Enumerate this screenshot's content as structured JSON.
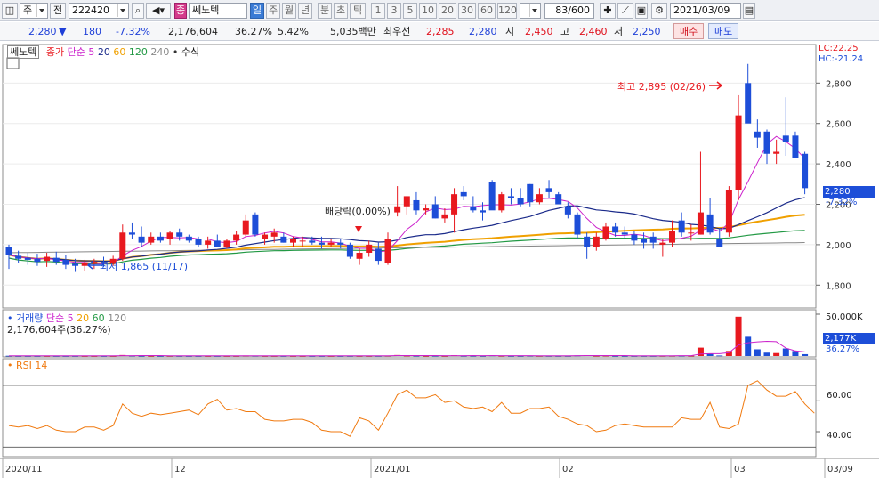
{
  "toolbar": {
    "market_tab": "주",
    "prev_label": "전",
    "code": "222420",
    "stock_name": "쎄노텍",
    "name_badge": "종",
    "periods": [
      "일",
      "주",
      "월",
      "년",
      "분",
      "초",
      "틱"
    ],
    "active_period": "일",
    "intervals": [
      "1",
      "3",
      "5",
      "10",
      "20",
      "30",
      "60",
      "120"
    ],
    "count": "83/600",
    "date": "2021/03/09"
  },
  "quote": {
    "price": "2,280",
    "direction": "▼",
    "change": "180",
    "change_pct": "-7.32%",
    "volume": "2,176,604",
    "volume_ratio": "36.27%",
    "turnover": "5.42%",
    "amount": "5,035백만",
    "best_label": "최우선",
    "best_ask": "2,285",
    "best_bid": "2,280",
    "open_label": "시",
    "open": "2,450",
    "high_label": "고",
    "high": "2,460",
    "low_label": "저",
    "low": "2,250",
    "buy_label": "매수",
    "sell_label": "매도"
  },
  "price_legend": {
    "name": "쎄노텍",
    "close_label": "종가",
    "ma_label": "단순",
    "ma_periods": [
      "5",
      "20",
      "60",
      "120",
      "240"
    ],
    "formula_label": "수식",
    "lc": "LC:22.25",
    "hc": "HC:-21.24",
    "last_price": "2,280",
    "last_pct": "-7.32%",
    "high_note": "최고 2,895 (02/26)",
    "low_note": "최저 1,865 (11/17)",
    "dividend_note": "배당락(0.00%)"
  },
  "volume_legend": {
    "name": "거래량",
    "ma_label": "단순",
    "ma_periods": [
      "5",
      "20",
      "60",
      "120"
    ],
    "current": "2,176,604주(36.27%)",
    "axis_top": "50,000K",
    "last_value": "2,177K",
    "last_pct": "36.27%"
  },
  "rsi_legend": {
    "name": "RSI 14",
    "ticks": [
      "60.00",
      "40.00"
    ]
  },
  "colors": {
    "up": "#e8191f",
    "down": "#1d4ed8",
    "ma5": "#cc22cc",
    "ma20": "#1a2a8a",
    "ma60": "#f0a000",
    "ma120": "#229944",
    "ma240": "#888888",
    "rsi": "#f07a10"
  },
  "chart_data": {
    "type": "candlestick",
    "price_ticks": [
      2800,
      2600,
      2400,
      2200,
      2000,
      1800
    ],
    "price_ylim": [
      1700,
      2960
    ],
    "x_labels": [
      "2020/11",
      "12",
      "2021/01",
      "02",
      "03",
      "03/09"
    ],
    "candles": [
      {
        "o": 1990,
        "h": 2000,
        "l": 1880,
        "c": 1950
      },
      {
        "o": 1945,
        "h": 1970,
        "l": 1910,
        "c": 1930
      },
      {
        "o": 1935,
        "h": 1960,
        "l": 1900,
        "c": 1925
      },
      {
        "o": 1930,
        "h": 1955,
        "l": 1895,
        "c": 1915
      },
      {
        "o": 1920,
        "h": 1960,
        "l": 1890,
        "c": 1940
      },
      {
        "o": 1935,
        "h": 1965,
        "l": 1900,
        "c": 1915
      },
      {
        "o": 1925,
        "h": 1950,
        "l": 1880,
        "c": 1900
      },
      {
        "o": 1905,
        "h": 1930,
        "l": 1865,
        "c": 1895
      },
      {
        "o": 1895,
        "h": 1925,
        "l": 1870,
        "c": 1910
      },
      {
        "o": 1905,
        "h": 1930,
        "l": 1880,
        "c": 1915
      },
      {
        "o": 1915,
        "h": 1940,
        "l": 1890,
        "c": 1905
      },
      {
        "o": 1905,
        "h": 1945,
        "l": 1895,
        "c": 1930
      },
      {
        "o": 1930,
        "h": 2100,
        "l": 1920,
        "c": 2060
      },
      {
        "o": 2060,
        "h": 2110,
        "l": 2030,
        "c": 2050
      },
      {
        "o": 2040,
        "h": 2090,
        "l": 1990,
        "c": 2010
      },
      {
        "o": 2010,
        "h": 2060,
        "l": 2000,
        "c": 2040
      },
      {
        "o": 2040,
        "h": 2060,
        "l": 2010,
        "c": 2020
      },
      {
        "o": 2030,
        "h": 2070,
        "l": 2000,
        "c": 2060
      },
      {
        "o": 2060,
        "h": 2080,
        "l": 2020,
        "c": 2040
      },
      {
        "o": 2040,
        "h": 2050,
        "l": 2010,
        "c": 2020
      },
      {
        "o": 2030,
        "h": 2040,
        "l": 1990,
        "c": 2000
      },
      {
        "o": 2000,
        "h": 2040,
        "l": 1980,
        "c": 2020
      },
      {
        "o": 2020,
        "h": 2050,
        "l": 1990,
        "c": 1990
      },
      {
        "o": 1990,
        "h": 2030,
        "l": 1980,
        "c": 2020
      },
      {
        "o": 2020,
        "h": 2070,
        "l": 2000,
        "c": 2050
      },
      {
        "o": 2050,
        "h": 2150,
        "l": 2040,
        "c": 2120
      },
      {
        "o": 2150,
        "h": 2160,
        "l": 2040,
        "c": 2050
      },
      {
        "o": 2030,
        "h": 2060,
        "l": 2000,
        "c": 2050
      },
      {
        "o": 2040,
        "h": 2080,
        "l": 2010,
        "c": 2060
      },
      {
        "o": 2040,
        "h": 2060,
        "l": 2010,
        "c": 2010
      },
      {
        "o": 2010,
        "h": 2040,
        "l": 1990,
        "c": 2030
      },
      {
        "o": 2020,
        "h": 2040,
        "l": 1990,
        "c": 2020
      },
      {
        "o": 2020,
        "h": 2040,
        "l": 2000,
        "c": 2010
      },
      {
        "o": 2010,
        "h": 2040,
        "l": 1980,
        "c": 2000
      },
      {
        "o": 2000,
        "h": 2030,
        "l": 1990,
        "c": 2010
      },
      {
        "o": 2010,
        "h": 2030,
        "l": 1980,
        "c": 2000
      },
      {
        "o": 2000,
        "h": 2010,
        "l": 1930,
        "c": 1940
      },
      {
        "o": 1930,
        "h": 1980,
        "l": 1900,
        "c": 1960
      },
      {
        "o": 1960,
        "h": 2020,
        "l": 1940,
        "c": 2000
      },
      {
        "o": 1980,
        "h": 2010,
        "l": 1900,
        "c": 1920
      },
      {
        "o": 1910,
        "h": 2060,
        "l": 1900,
        "c": 2030
      },
      {
        "o": 2160,
        "h": 2290,
        "l": 2140,
        "c": 2190
      },
      {
        "o": 2190,
        "h": 2240,
        "l": 2150,
        "c": 2240
      },
      {
        "o": 2220,
        "h": 2260,
        "l": 2150,
        "c": 2170
      },
      {
        "o": 2170,
        "h": 2200,
        "l": 2150,
        "c": 2180
      },
      {
        "o": 2200,
        "h": 2240,
        "l": 2130,
        "c": 2130
      },
      {
        "o": 2130,
        "h": 2180,
        "l": 2110,
        "c": 2150
      },
      {
        "o": 2150,
        "h": 2280,
        "l": 2060,
        "c": 2250
      },
      {
        "o": 2260,
        "h": 2290,
        "l": 2220,
        "c": 2240
      },
      {
        "o": 2190,
        "h": 2240,
        "l": 2160,
        "c": 2170
      },
      {
        "o": 2170,
        "h": 2210,
        "l": 2120,
        "c": 2160
      },
      {
        "o": 2310,
        "h": 2320,
        "l": 2180,
        "c": 2170
      },
      {
        "o": 2170,
        "h": 2260,
        "l": 2160,
        "c": 2250
      },
      {
        "o": 2240,
        "h": 2280,
        "l": 2200,
        "c": 2230
      },
      {
        "o": 2230,
        "h": 2280,
        "l": 2190,
        "c": 2200
      },
      {
        "o": 2300,
        "h": 2300,
        "l": 2190,
        "c": 2210
      },
      {
        "o": 2210,
        "h": 2280,
        "l": 2200,
        "c": 2250
      },
      {
        "o": 2280,
        "h": 2320,
        "l": 2230,
        "c": 2260
      },
      {
        "o": 2250,
        "h": 2260,
        "l": 2200,
        "c": 2200
      },
      {
        "o": 2190,
        "h": 2210,
        "l": 2130,
        "c": 2150
      },
      {
        "o": 2150,
        "h": 2160,
        "l": 2030,
        "c": 2050
      },
      {
        "o": 2040,
        "h": 2060,
        "l": 1930,
        "c": 1990
      },
      {
        "o": 1990,
        "h": 2060,
        "l": 1970,
        "c": 2040
      },
      {
        "o": 2030,
        "h": 2110,
        "l": 2020,
        "c": 2090
      },
      {
        "o": 2090,
        "h": 2110,
        "l": 2040,
        "c": 2060
      },
      {
        "o": 2060,
        "h": 2090,
        "l": 2030,
        "c": 2050
      },
      {
        "o": 2050,
        "h": 2070,
        "l": 2000,
        "c": 2020
      },
      {
        "o": 2030,
        "h": 2060,
        "l": 1980,
        "c": 2010
      },
      {
        "o": 2040,
        "h": 2060,
        "l": 1980,
        "c": 2010
      },
      {
        "o": 2000,
        "h": 2030,
        "l": 1940,
        "c": 2010
      },
      {
        "o": 2010,
        "h": 2120,
        "l": 1990,
        "c": 2070
      },
      {
        "o": 2120,
        "h": 2160,
        "l": 2040,
        "c": 2060
      },
      {
        "o": 2060,
        "h": 2100,
        "l": 2020,
        "c": 2060
      },
      {
        "o": 2050,
        "h": 2460,
        "l": 2050,
        "c": 2160
      },
      {
        "o": 2150,
        "h": 2230,
        "l": 2050,
        "c": 2060
      },
      {
        "o": 2030,
        "h": 2080,
        "l": 1990,
        "c": 1990
      },
      {
        "o": 2060,
        "h": 2290,
        "l": 2040,
        "c": 2270
      },
      {
        "o": 2270,
        "h": 2740,
        "l": 2220,
        "c": 2640
      },
      {
        "o": 2800,
        "h": 2895,
        "l": 2650,
        "c": 2600
      },
      {
        "o": 2560,
        "h": 2620,
        "l": 2480,
        "c": 2530
      },
      {
        "o": 2560,
        "h": 2570,
        "l": 2400,
        "c": 2450
      },
      {
        "o": 2450,
        "h": 2520,
        "l": 2400,
        "c": 2460
      },
      {
        "o": 2540,
        "h": 2730,
        "l": 2440,
        "c": 2510
      },
      {
        "o": 2540,
        "h": 2560,
        "l": 2440,
        "c": 2430
      },
      {
        "o": 2450,
        "h": 2460,
        "l": 2250,
        "c": 2280
      }
    ],
    "volume_scale_max": 50000,
    "volumes": [
      300,
      200,
      200,
      200,
      200,
      200,
      200,
      250,
      200,
      200,
      200,
      200,
      1200,
      500,
      300,
      300,
      250,
      300,
      250,
      200,
      200,
      200,
      200,
      200,
      250,
      600,
      500,
      250,
      250,
      250,
      200,
      200,
      200,
      200,
      200,
      200,
      300,
      250,
      250,
      300,
      500,
      1200,
      500,
      400,
      300,
      400,
      300,
      900,
      400,
      400,
      300,
      700,
      400,
      300,
      300,
      500,
      350,
      350,
      300,
      350,
      700,
      900,
      400,
      500,
      300,
      300,
      300,
      300,
      300,
      400,
      500,
      500,
      400,
      10000,
      2500,
      600,
      6000,
      47000,
      23000,
      8000,
      4000,
      3500,
      9000,
      6000,
      2177
    ],
    "rsi_ticks": [
      60,
      40
    ],
    "rsi_ylim": [
      25,
      85
    ],
    "rsi": [
      44,
      43,
      44,
      42,
      44,
      41,
      40,
      40,
      43,
      43,
      41,
      44,
      58,
      52,
      50,
      52,
      51,
      52,
      53,
      54,
      51,
      58,
      61,
      54,
      55,
      53,
      53,
      48,
      47,
      47,
      48,
      48,
      46,
      41,
      40,
      40,
      37,
      49,
      47,
      41,
      52,
      64,
      67,
      62,
      62,
      64,
      59,
      60,
      56,
      55,
      56,
      53,
      59,
      52,
      52,
      55,
      55,
      56,
      50,
      48,
      45,
      44,
      40,
      41,
      44,
      45,
      44,
      43,
      43,
      43,
      43,
      49,
      48,
      48,
      59,
      43,
      42,
      45,
      70,
      73,
      67,
      63,
      63,
      66,
      58,
      52
    ]
  }
}
